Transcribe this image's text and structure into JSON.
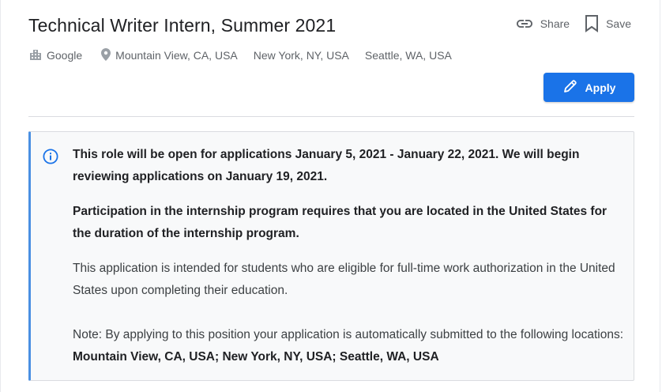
{
  "job": {
    "title": "Technical Writer Intern, Summer 2021",
    "company": "Google",
    "locations": [
      "Mountain View, CA, USA",
      "New York, NY, USA",
      "Seattle, WA, USA"
    ]
  },
  "actions": {
    "share_label": "Share",
    "save_label": "Save",
    "apply_label": "Apply"
  },
  "notice": {
    "line1": "This role will be open for applications January 5, 2021 - January 22, 2021. We will begin reviewing applications on January 19, 2021.",
    "line2": "Participation in the internship program requires that you are located in the United States for the duration of the internship program.",
    "line3": "This application is intended for students who are eligible for full-time work authorization in the United States upon completing their education.",
    "note_prefix": "Note: By applying to this position your application is automatically submitted to the following locations: ",
    "note_locations": "Mountain View, CA, USA; New York, NY, USA; Seattle, WA, USA"
  },
  "icons": {
    "company": "building-icon",
    "location": "location-pin-icon",
    "share": "link-icon",
    "save": "bookmark-icon",
    "apply": "pencil-icon",
    "info": "info-icon"
  },
  "colors": {
    "accent": "#1a73e8",
    "notice_border": "#4a90e2",
    "notice_bg": "#f8f9fa",
    "muted_text": "#5f6368"
  }
}
